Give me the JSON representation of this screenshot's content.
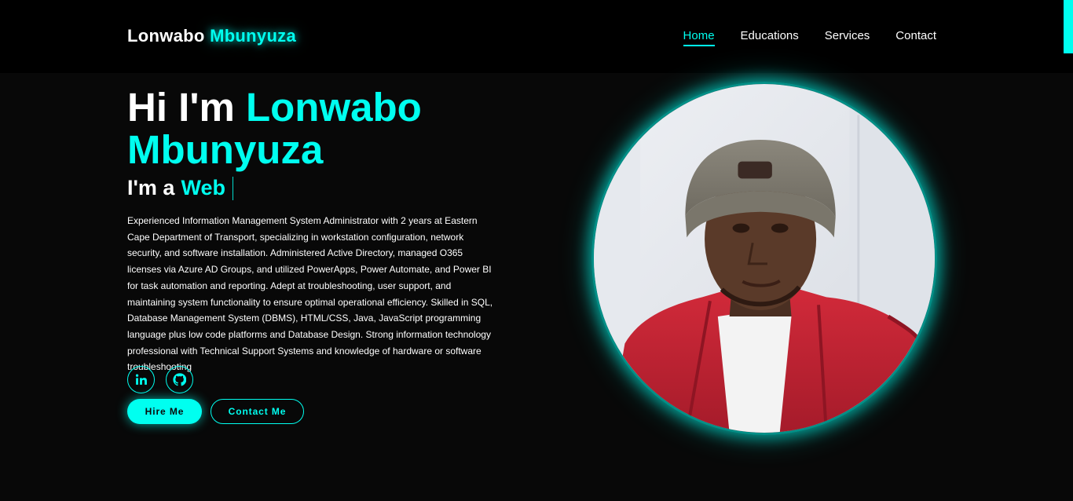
{
  "header": {
    "logo_first": "Lonwabo",
    "logo_last": "Mbunyuza",
    "nav": [
      {
        "label": "Home",
        "active": true
      },
      {
        "label": "Educations",
        "active": false
      },
      {
        "label": "Services",
        "active": false
      },
      {
        "label": "Contact",
        "active": false
      }
    ]
  },
  "hero": {
    "greeting": "Hi I'm",
    "name": "Lonwabo Mbunyuza",
    "role_prefix": "I'm a",
    "role_value": "Web",
    "bio": "Experienced Information Management System Administrator with 2 years at Eastern Cape Department of Transport, specializing in workstation configuration, network security, and software installation. Administered Active Directory, managed O365 licenses via Azure AD Groups, and utilized PowerApps, Power Automate, and Power BI for task automation and reporting. Adept at troubleshooting, user support, and maintaining system functionality to ensure optimal operational efficiency. Skilled in SQL, Database Management System (DBMS), HTML/CSS, Java, JavaScript programming language plus low code platforms and Database Design. Strong information technology professional with Technical Support Systems and knowledge of hardware or software troubleshooting",
    "socials": [
      {
        "icon": "linkedin-icon",
        "glyph": "in"
      },
      {
        "icon": "github-icon"
      }
    ],
    "buttons": {
      "hire": "Hire Me",
      "contact": "Contact Me"
    }
  },
  "colors": {
    "accent": "#00fff0",
    "background": "#080808",
    "header_bg": "#000000"
  }
}
